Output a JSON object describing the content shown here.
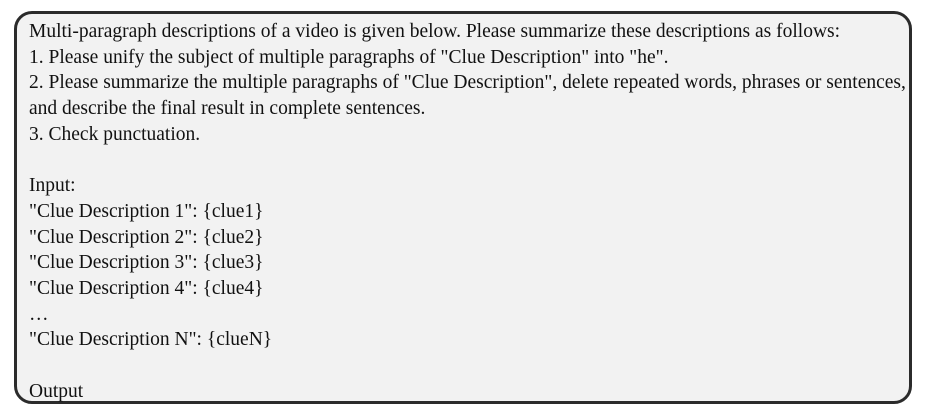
{
  "intro": "Multi-paragraph descriptions of a video is given below. Please summarize these descriptions as follows:",
  "instructions": [
    "1. Please unify the subject of multiple paragraphs of \"Clue Description\" into \"he\".",
    "2. Please summarize the multiple paragraphs of \"Clue Description\", delete repeated words, phrases or sentences, and describe the final result in complete sentences.",
    "3. Check punctuation."
  ],
  "input_label": "Input:",
  "clues": [
    "\"Clue Description 1\": {clue1}",
    "\"Clue Description 2\": {clue2}",
    "\"Clue Description 3\": {clue3}",
    "\"Clue Description 4\": {clue4}"
  ],
  "ellipsis": "…",
  "clue_n": "\"Clue Description N\": {clueN}",
  "output_label": "Output"
}
